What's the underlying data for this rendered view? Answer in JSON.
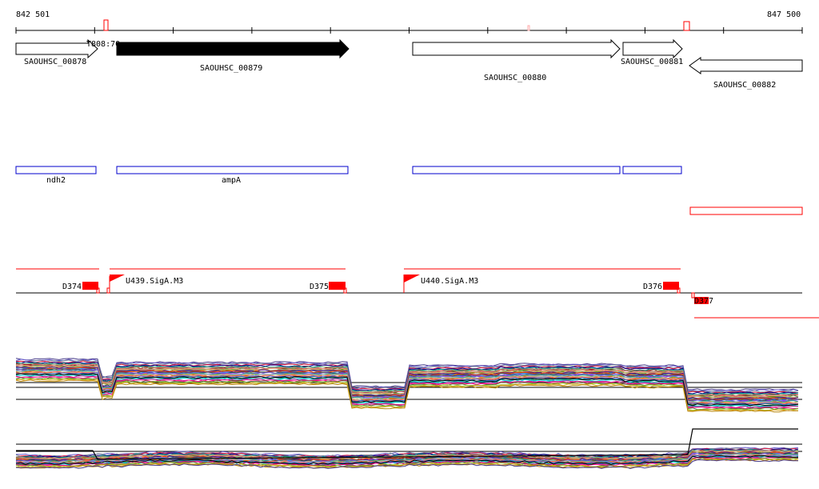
{
  "coords": {
    "start": "842 501",
    "end": "847 500"
  },
  "ruler_tick_count": 10,
  "genes": [
    {
      "id": "SAOUHSC_00878",
      "strand": "+",
      "filled": false
    },
    {
      "id": "SAOUHSC_00879",
      "strand": "+",
      "filled": true
    },
    {
      "id": "SAOUHSC_00880",
      "strand": "+",
      "filled": false
    },
    {
      "id": "SAOUHSC_00881",
      "strand": "+",
      "filled": false
    },
    {
      "id": "SAOUHSC_00882",
      "strand": "-",
      "filled": false
    }
  ],
  "gene_overlap_label": "T808:70",
  "gene_names": [
    "ndh2",
    "ampA"
  ],
  "operon_blue_boxes": 4,
  "terminators": [
    "D374",
    "D375",
    "D376",
    "D377"
  ],
  "promoters": [
    "U439.SigA.M3",
    "U440.SigA.M3"
  ],
  "colors": {
    "gene_fill": "#000000",
    "operon_box": "#0000cc",
    "annotation_red": "#ff0000",
    "axis": "#000000"
  },
  "expression_panels": [
    {
      "name": "upper-strand-profiles",
      "trace_count": 40
    },
    {
      "name": "lower-strand-profiles",
      "trace_count": 40
    }
  ]
}
